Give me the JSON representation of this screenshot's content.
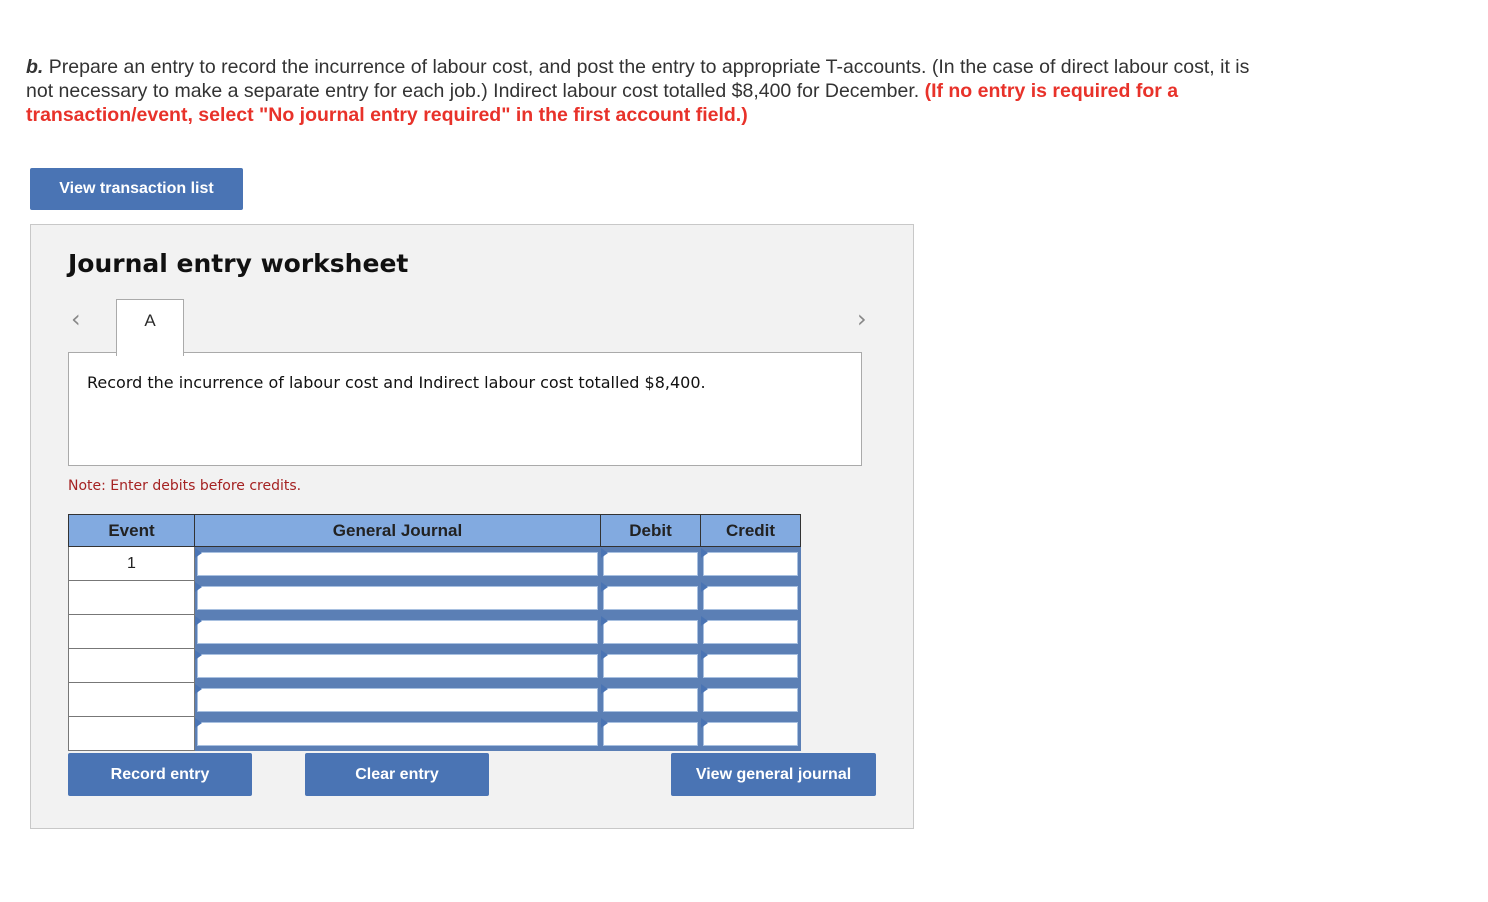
{
  "question": {
    "label": "b.",
    "text": " Prepare an entry to record the incurrence of labour cost, and post the entry to appropriate T-accounts. (In the case of direct labour cost, it is not necessary to make a separate entry for each job.) Indirect labour cost totalled $8,400 for December. ",
    "warning": "(If no entry is required for a transaction/event, select \"No journal entry required\" in the first account field.)"
  },
  "buttons": {
    "view_transaction_list": "View transaction list",
    "record_entry": "Record entry",
    "clear_entry": "Clear entry",
    "view_general_journal": "View general journal"
  },
  "worksheet": {
    "title": "Journal entry worksheet",
    "prev_icon": "‹",
    "next_icon": "›",
    "tabs": [
      {
        "label": "A"
      }
    ],
    "description": "Record the incurrence of labour cost and Indirect labour cost totalled $8,400.",
    "note": "Note: Enter debits before credits."
  },
  "journal": {
    "headers": [
      "Event",
      "General Journal",
      "Debit",
      "Credit"
    ],
    "rows": [
      {
        "event": "1",
        "account": "",
        "debit": "",
        "credit": ""
      },
      {
        "event": "",
        "account": "",
        "debit": "",
        "credit": ""
      },
      {
        "event": "",
        "account": "",
        "debit": "",
        "credit": ""
      },
      {
        "event": "",
        "account": "",
        "debit": "",
        "credit": ""
      },
      {
        "event": "",
        "account": "",
        "debit": "",
        "credit": ""
      },
      {
        "event": "",
        "account": "",
        "debit": "",
        "credit": ""
      }
    ]
  }
}
